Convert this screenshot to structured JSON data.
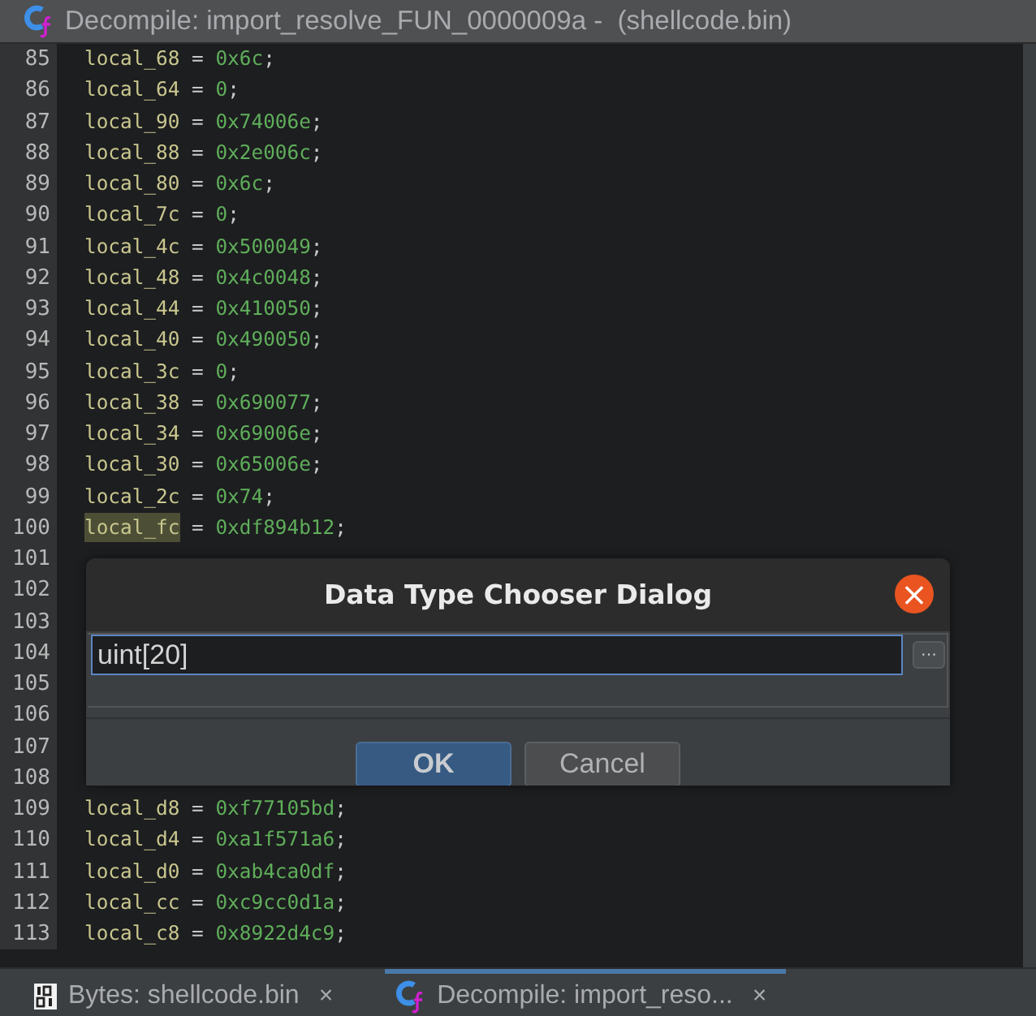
{
  "window": {
    "title": "Decompile: import_resolve_FUN_0000009a -  (shellcode.bin)"
  },
  "code_lines": [
    {
      "number": "85",
      "name": "local_68",
      "op": "=",
      "value": "0x6c",
      "end": ";",
      "highlighted": false
    },
    {
      "number": "86",
      "name": "local_64",
      "op": "=",
      "value": "0",
      "end": ";",
      "highlighted": false
    },
    {
      "number": "87",
      "name": "local_90",
      "op": "=",
      "value": "0x74006e",
      "end": ";",
      "highlighted": false
    },
    {
      "number": "88",
      "name": "local_88",
      "op": "=",
      "value": "0x2e006c",
      "end": ";",
      "highlighted": false
    },
    {
      "number": "89",
      "name": "local_80",
      "op": "=",
      "value": "0x6c",
      "end": ";",
      "highlighted": false
    },
    {
      "number": "90",
      "name": "local_7c",
      "op": "=",
      "value": "0",
      "end": ";",
      "highlighted": false
    },
    {
      "number": "91",
      "name": "local_4c",
      "op": "=",
      "value": "0x500049",
      "end": ";",
      "highlighted": false
    },
    {
      "number": "92",
      "name": "local_48",
      "op": "=",
      "value": "0x4c0048",
      "end": ";",
      "highlighted": false
    },
    {
      "number": "93",
      "name": "local_44",
      "op": "=",
      "value": "0x410050",
      "end": ";",
      "highlighted": false
    },
    {
      "number": "94",
      "name": "local_40",
      "op": "=",
      "value": "0x490050",
      "end": ";",
      "highlighted": false
    },
    {
      "number": "95",
      "name": "local_3c",
      "op": "=",
      "value": "0",
      "end": ";",
      "highlighted": false
    },
    {
      "number": "96",
      "name": "local_38",
      "op": "=",
      "value": "0x690077",
      "end": ";",
      "highlighted": false
    },
    {
      "number": "97",
      "name": "local_34",
      "op": "=",
      "value": "0x69006e",
      "end": ";",
      "highlighted": false
    },
    {
      "number": "98",
      "name": "local_30",
      "op": "=",
      "value": "0x65006e",
      "end": ";",
      "highlighted": false
    },
    {
      "number": "99",
      "name": "local_2c",
      "op": "=",
      "value": "0x74",
      "end": ";",
      "highlighted": false
    },
    {
      "number": "100",
      "name": "local_fc",
      "op": "=",
      "value": "0xdf894b12",
      "end": ";",
      "highlighted": true
    },
    {
      "number": "101"
    },
    {
      "number": "102"
    },
    {
      "number": "103"
    },
    {
      "number": "104"
    },
    {
      "number": "105"
    },
    {
      "number": "106"
    },
    {
      "number": "107"
    },
    {
      "number": "108"
    },
    {
      "number": "109",
      "name": "local_d8",
      "op": "=",
      "value": "0xf77105bd",
      "end": ";",
      "highlighted": false
    },
    {
      "number": "110",
      "name": "local_d4",
      "op": "=",
      "value": "0xa1f571a6",
      "end": ";",
      "highlighted": false
    },
    {
      "number": "111",
      "name": "local_d0",
      "op": "=",
      "value": "0xab4ca0df",
      "end": ";",
      "highlighted": false
    },
    {
      "number": "112",
      "name": "local_cc",
      "op": "=",
      "value": "0xc9cc0d1a",
      "end": ";",
      "highlighted": false
    },
    {
      "number": "113",
      "name": "local_c8",
      "op": "=",
      "value": "0x8922d4c9",
      "end": ";",
      "highlighted": false
    }
  ],
  "dialog": {
    "title": "Data Type Chooser Dialog",
    "close": "×",
    "value": "uint[20]",
    "browse": "···",
    "buttons": [
      {
        "label": "OK",
        "selected": true
      },
      {
        "label": "Cancel",
        "selected": false
      }
    ]
  },
  "tabs": [
    {
      "kind": "bytes",
      "label": "Bytes: shellcode.bin",
      "close": "×",
      "selected": false
    },
    {
      "kind": "decompile",
      "label": "Decompile: import_reso...",
      "close": "×",
      "selected": true
    }
  ]
}
